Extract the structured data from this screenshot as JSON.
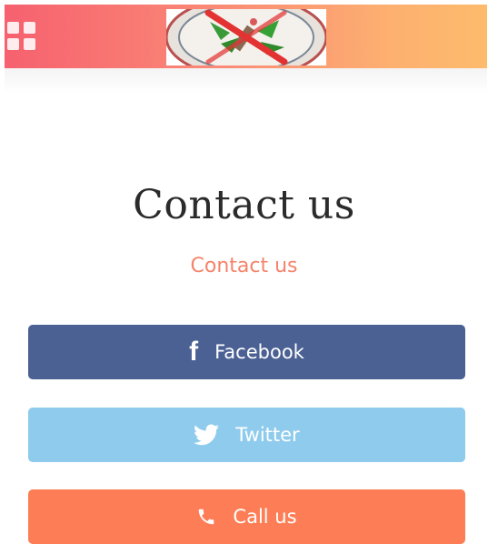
{
  "header": {
    "menu_icon": "grid-menu-icon",
    "logo_icon": "no-smoking-no-cannabis-logo-icon"
  },
  "main": {
    "title": "Contact us",
    "subtitle": "Contact us"
  },
  "buttons": {
    "facebook": {
      "label": "Facebook",
      "icon": "facebook-icon",
      "color": "#4b6194"
    },
    "twitter": {
      "label": "Twitter",
      "icon": "twitter-bird-icon",
      "color": "#8ecbec"
    },
    "call": {
      "label": "Call us",
      "icon": "phone-icon",
      "color": "#fd7e56"
    }
  },
  "colors": {
    "header_gradient_start": "#f6616f",
    "header_gradient_end": "#fdbb6c",
    "subtitle": "#f5836a",
    "title": "#2b2b2b"
  }
}
